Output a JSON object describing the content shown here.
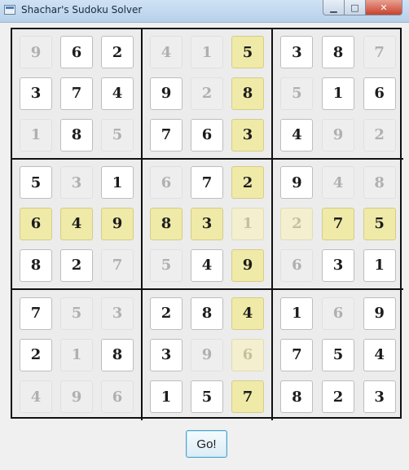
{
  "window": {
    "title": "Shachar's Sudoku Solver",
    "minimize_glyph": "▁",
    "maximize_glyph": "□",
    "close_glyph": "✕"
  },
  "board": {
    "rows": [
      [
        {
          "v": "9",
          "s": "solved"
        },
        {
          "v": "6",
          "s": "given"
        },
        {
          "v": "2",
          "s": "given"
        },
        {
          "v": "4",
          "s": "solved"
        },
        {
          "v": "1",
          "s": "solved"
        },
        {
          "v": "5",
          "s": "hl"
        },
        {
          "v": "3",
          "s": "given"
        },
        {
          "v": "8",
          "s": "given"
        },
        {
          "v": "7",
          "s": "solved"
        }
      ],
      [
        {
          "v": "3",
          "s": "given"
        },
        {
          "v": "7",
          "s": "given"
        },
        {
          "v": "4",
          "s": "given"
        },
        {
          "v": "9",
          "s": "given"
        },
        {
          "v": "2",
          "s": "solved"
        },
        {
          "v": "8",
          "s": "hl"
        },
        {
          "v": "5",
          "s": "solved"
        },
        {
          "v": "1",
          "s": "given"
        },
        {
          "v": "6",
          "s": "given"
        }
      ],
      [
        {
          "v": "1",
          "s": "solved"
        },
        {
          "v": "8",
          "s": "given"
        },
        {
          "v": "5",
          "s": "solved"
        },
        {
          "v": "7",
          "s": "given"
        },
        {
          "v": "6",
          "s": "given"
        },
        {
          "v": "3",
          "s": "hl"
        },
        {
          "v": "4",
          "s": "given"
        },
        {
          "v": "9",
          "s": "solved"
        },
        {
          "v": "2",
          "s": "solved"
        }
      ],
      [
        {
          "v": "5",
          "s": "given"
        },
        {
          "v": "3",
          "s": "solved"
        },
        {
          "v": "1",
          "s": "given"
        },
        {
          "v": "6",
          "s": "solved"
        },
        {
          "v": "7",
          "s": "given"
        },
        {
          "v": "2",
          "s": "hl"
        },
        {
          "v": "9",
          "s": "given"
        },
        {
          "v": "4",
          "s": "solved"
        },
        {
          "v": "8",
          "s": "solved"
        }
      ],
      [
        {
          "v": "6",
          "s": "hl"
        },
        {
          "v": "4",
          "s": "hl"
        },
        {
          "v": "9",
          "s": "hl"
        },
        {
          "v": "8",
          "s": "hl"
        },
        {
          "v": "3",
          "s": "hl"
        },
        {
          "v": "1",
          "s": "hl-faint"
        },
        {
          "v": "2",
          "s": "hl-faint"
        },
        {
          "v": "7",
          "s": "hl"
        },
        {
          "v": "5",
          "s": "hl"
        }
      ],
      [
        {
          "v": "8",
          "s": "given"
        },
        {
          "v": "2",
          "s": "given"
        },
        {
          "v": "7",
          "s": "solved"
        },
        {
          "v": "5",
          "s": "solved"
        },
        {
          "v": "4",
          "s": "given"
        },
        {
          "v": "9",
          "s": "hl"
        },
        {
          "v": "6",
          "s": "solved"
        },
        {
          "v": "3",
          "s": "given"
        },
        {
          "v": "1",
          "s": "given"
        }
      ],
      [
        {
          "v": "7",
          "s": "given"
        },
        {
          "v": "5",
          "s": "solved"
        },
        {
          "v": "3",
          "s": "solved"
        },
        {
          "v": "2",
          "s": "given"
        },
        {
          "v": "8",
          "s": "given"
        },
        {
          "v": "4",
          "s": "hl"
        },
        {
          "v": "1",
          "s": "given"
        },
        {
          "v": "6",
          "s": "solved"
        },
        {
          "v": "9",
          "s": "given"
        }
      ],
      [
        {
          "v": "2",
          "s": "given"
        },
        {
          "v": "1",
          "s": "solved"
        },
        {
          "v": "8",
          "s": "given"
        },
        {
          "v": "3",
          "s": "given"
        },
        {
          "v": "9",
          "s": "solved"
        },
        {
          "v": "6",
          "s": "hl-faint"
        },
        {
          "v": "7",
          "s": "given"
        },
        {
          "v": "5",
          "s": "given"
        },
        {
          "v": "4",
          "s": "given"
        }
      ],
      [
        {
          "v": "4",
          "s": "solved"
        },
        {
          "v": "9",
          "s": "solved"
        },
        {
          "v": "6",
          "s": "solved"
        },
        {
          "v": "1",
          "s": "given"
        },
        {
          "v": "5",
          "s": "given"
        },
        {
          "v": "7",
          "s": "hl"
        },
        {
          "v": "8",
          "s": "given"
        },
        {
          "v": "2",
          "s": "given"
        },
        {
          "v": "3",
          "s": "given"
        }
      ]
    ]
  },
  "go_button": {
    "label": "Go!"
  },
  "colors": {
    "highlight": "#f0eaa8",
    "given_cell": "#ffffff",
    "solved_cell": "#eeeeee",
    "solved_text": "#b0b0b0"
  }
}
